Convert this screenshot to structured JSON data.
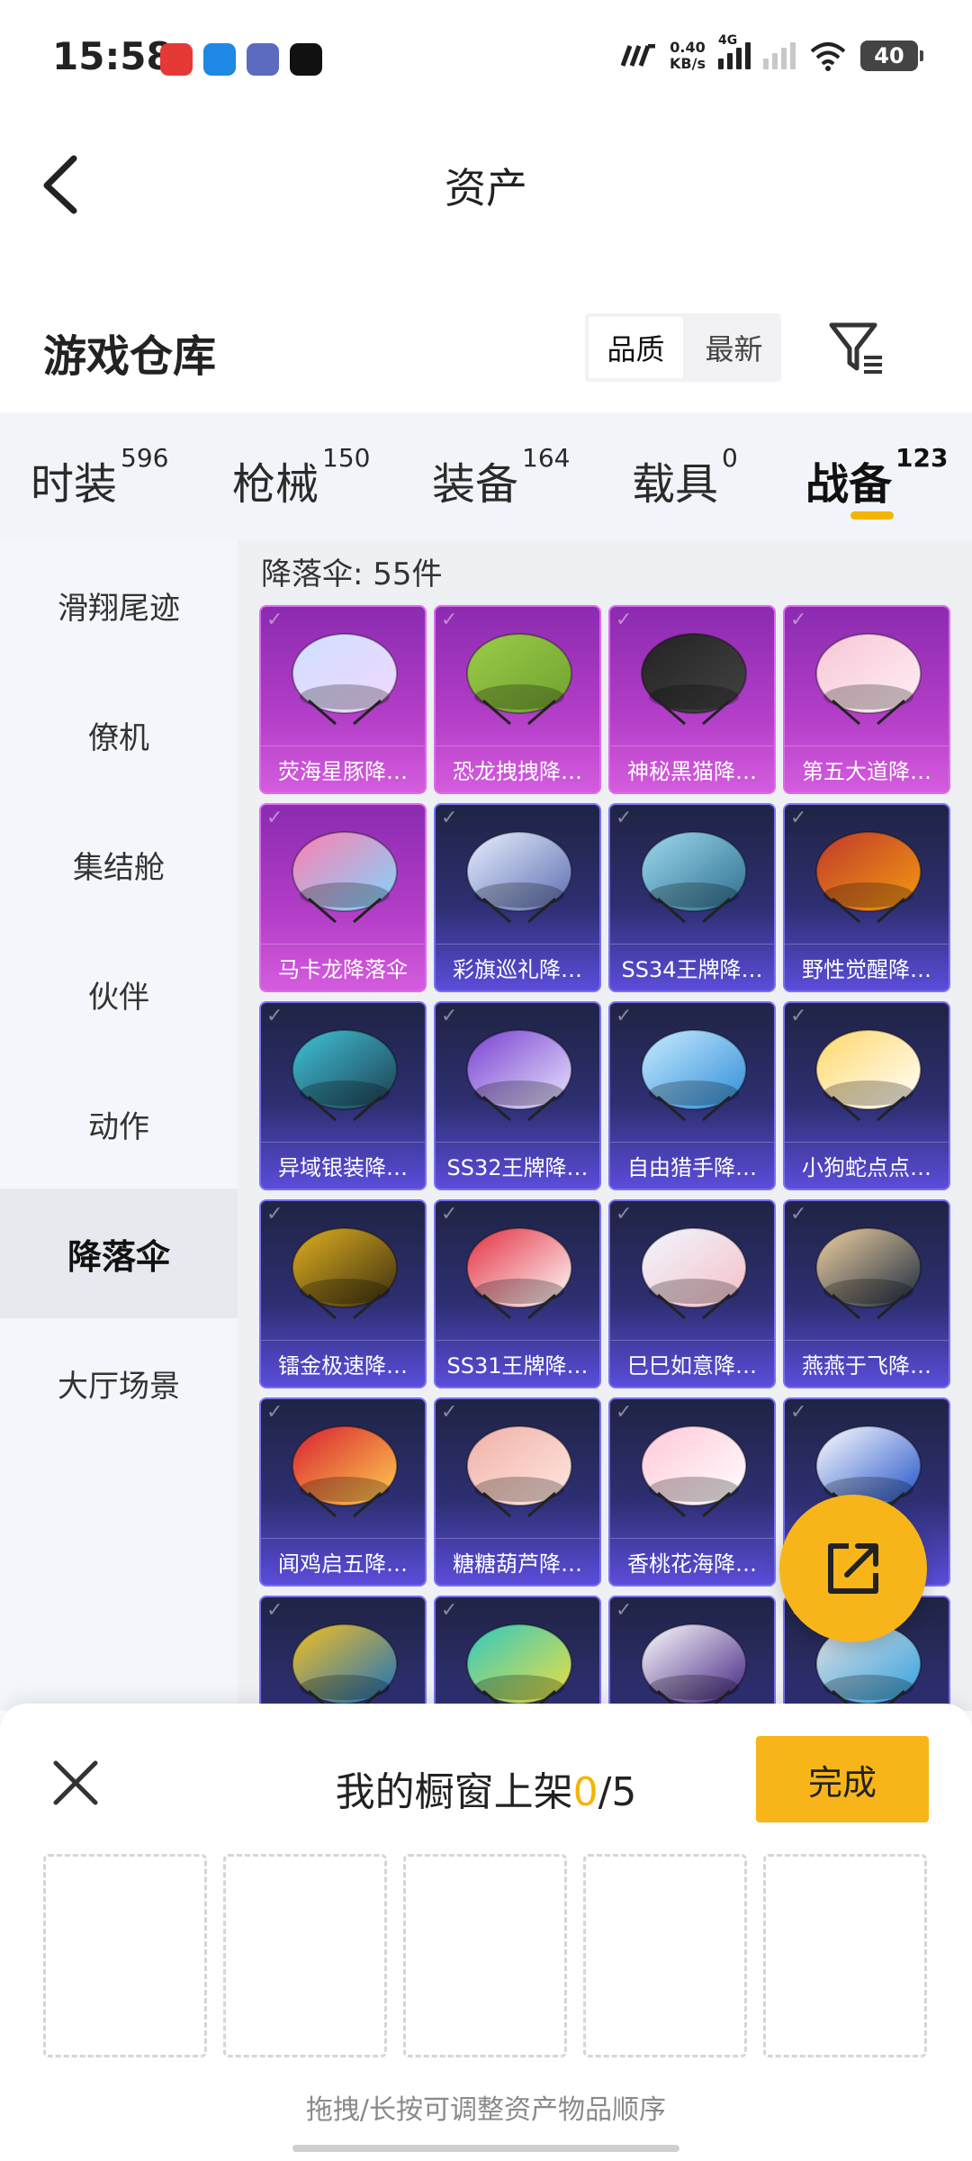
{
  "status_bar": {
    "time": "15:58",
    "app_icons": [
      "netease-music-icon",
      "app-blue-icon",
      "pet-app-icon",
      "tiktok-icon"
    ],
    "net_speed_value": "0.40",
    "net_speed_unit": "KB/s",
    "network": "4G",
    "battery": "40"
  },
  "header": {
    "title": "资产",
    "back_icon": "back-arrow-icon"
  },
  "section": {
    "title": "游戏仓库",
    "sort_options": [
      "品质",
      "最新"
    ],
    "sort_selected": "品质",
    "filter_icon": "filter-icon"
  },
  "tabs": [
    {
      "label": "时装",
      "count": "596"
    },
    {
      "label": "枪械",
      "count": "150"
    },
    {
      "label": "装备",
      "count": "164"
    },
    {
      "label": "载具",
      "count": "0"
    },
    {
      "label": "战备",
      "count": "123",
      "active": true
    }
  ],
  "sidebar": [
    {
      "label": "滑翔尾迹"
    },
    {
      "label": "僚机"
    },
    {
      "label": "集结舱"
    },
    {
      "label": "伙伴"
    },
    {
      "label": "动作"
    },
    {
      "label": "降落伞",
      "active": true
    },
    {
      "label": "大厅场景"
    }
  ],
  "grid": {
    "count_label": "降落伞: 55件",
    "items": [
      {
        "name": "荧海星豚降…",
        "tier": "purple"
      },
      {
        "name": "恐龙拽拽降…",
        "tier": "purple"
      },
      {
        "name": "神秘黑猫降…",
        "tier": "purple"
      },
      {
        "name": "第五大道降…",
        "tier": "purple"
      },
      {
        "name": "马卡龙降落伞",
        "tier": "purple"
      },
      {
        "name": "彩旗巡礼降…",
        "tier": "blue"
      },
      {
        "name": "SS34王牌降…",
        "tier": "blue"
      },
      {
        "name": "野性觉醒降…",
        "tier": "blue"
      },
      {
        "name": "异域银装降…",
        "tier": "blue"
      },
      {
        "name": "SS32王牌降…",
        "tier": "blue"
      },
      {
        "name": "自由猎手降…",
        "tier": "blue"
      },
      {
        "name": "小狗蛇点点…",
        "tier": "blue"
      },
      {
        "name": "镭金极速降…",
        "tier": "blue"
      },
      {
        "name": "SS31王牌降…",
        "tier": "blue"
      },
      {
        "name": "巳巳如意降…",
        "tier": "blue"
      },
      {
        "name": "燕燕于飞降…",
        "tier": "blue"
      },
      {
        "name": "闻鸡启五降…",
        "tier": "blue"
      },
      {
        "name": "糖糖葫芦降…",
        "tier": "blue"
      },
      {
        "name": "香桃花海降…",
        "tier": "blue"
      },
      {
        "name": "",
        "tier": "blue"
      },
      {
        "name": "",
        "tier": "blue"
      },
      {
        "name": "",
        "tier": "blue"
      },
      {
        "name": "",
        "tier": "blue"
      },
      {
        "name": "",
        "tier": "blue"
      }
    ]
  },
  "share_button": {
    "icon": "share-icon"
  },
  "showcase": {
    "title_prefix": "我的橱窗上架",
    "current": "0",
    "total": "/5",
    "done_label": "完成",
    "close_icon": "close-icon",
    "slots": 5,
    "hint": "拖拽/长按可调整资产物品顺序"
  },
  "colors": {
    "accent": "#f8b51a",
    "highlight": "#f5b400",
    "tier_purple": "#b43ec8",
    "tier_blue": "#2e2f72"
  }
}
